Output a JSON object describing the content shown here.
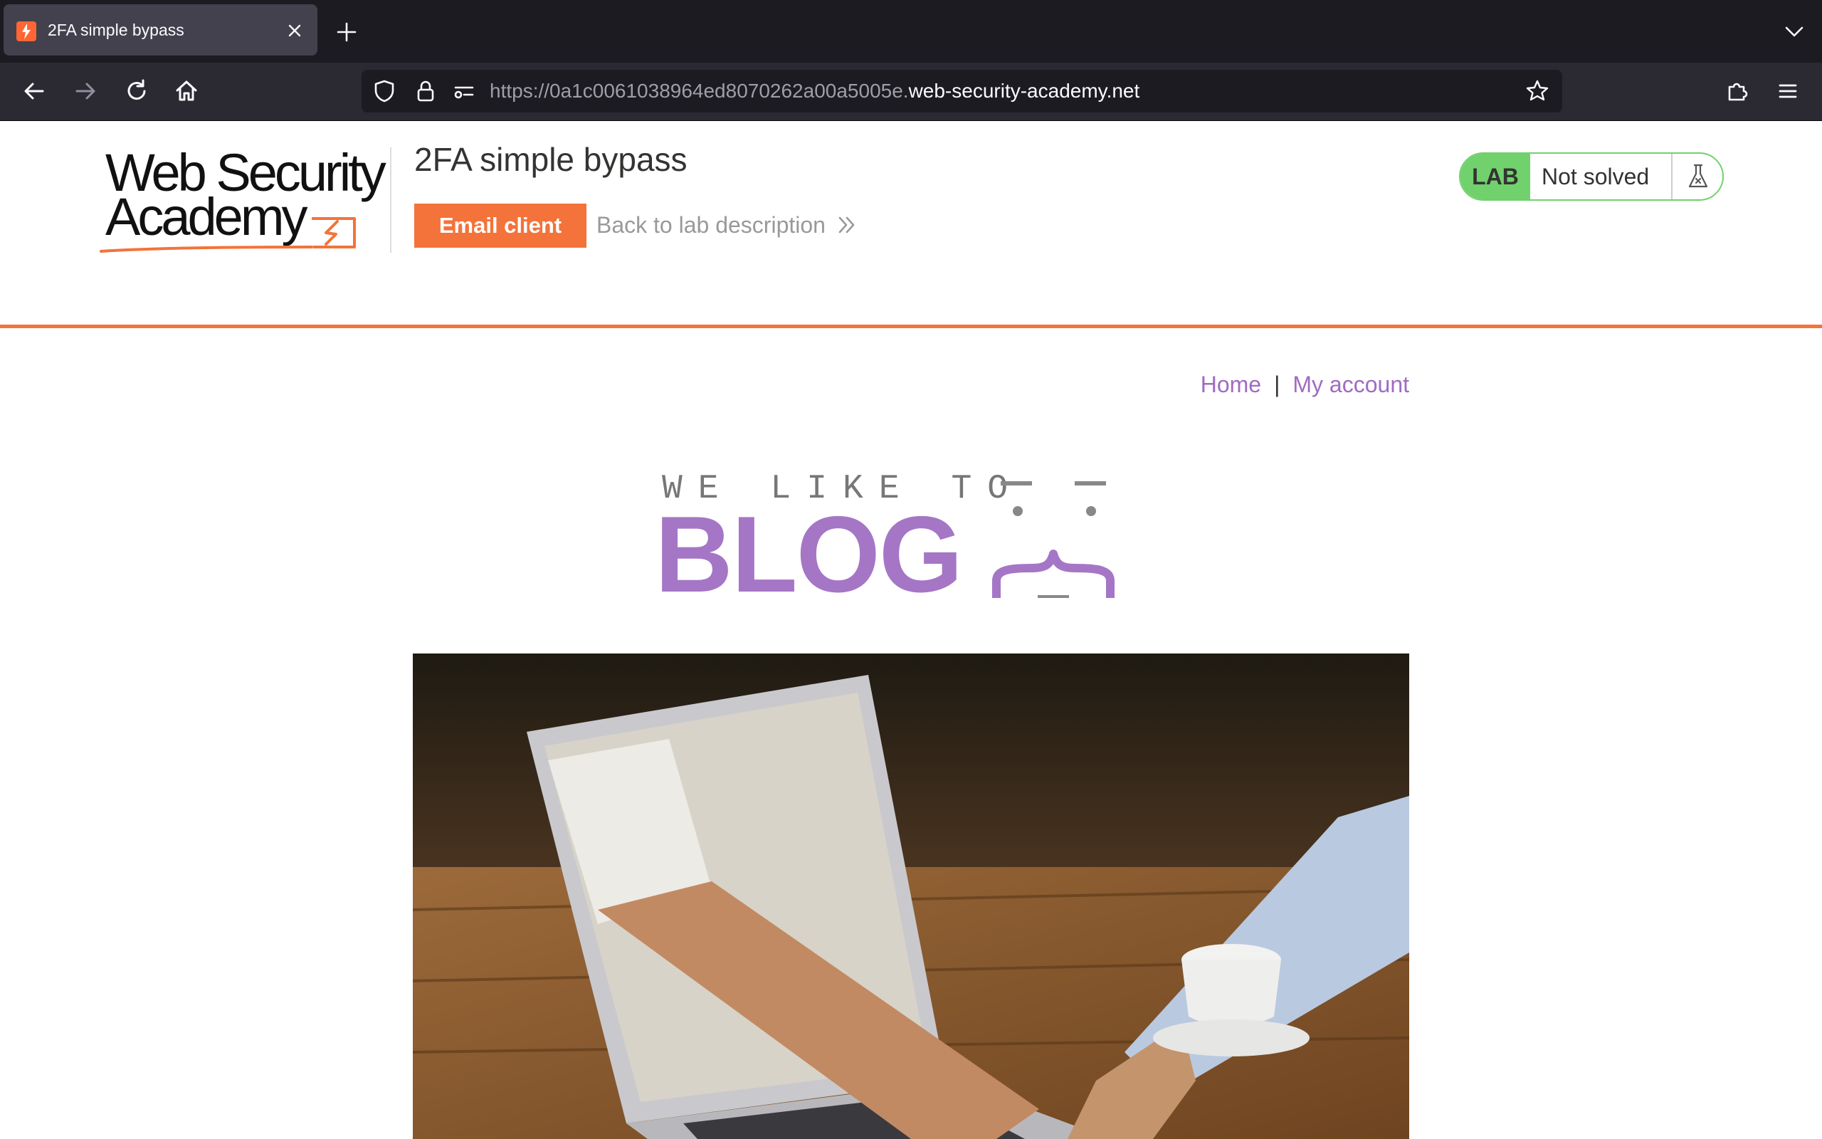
{
  "browser": {
    "tab": {
      "title": "2FA simple bypass"
    },
    "url": {
      "prefix": "https://0a1c0061038964ed8070262a00a5005e.",
      "domain": "web-security-academy.net"
    }
  },
  "header": {
    "logo": {
      "line1": "Web Security",
      "line2": "Academy"
    },
    "lab_title": "2FA simple bypass",
    "email_button": "Email client",
    "back_link": "Back to lab description",
    "status": {
      "badge": "LAB",
      "text": "Not solved"
    }
  },
  "nav": {
    "home": "Home",
    "separator": "|",
    "my_account": "My account"
  },
  "banner": {
    "tagline": "WE LIKE TO",
    "title": "BLOG"
  },
  "colors": {
    "accent": "#f3733a",
    "link": "#a06bc3",
    "lab_green": "#70d16d",
    "blog_purple": "#a576c6"
  },
  "icons": {
    "toolbar": [
      "back-icon",
      "forward-icon",
      "reload-icon",
      "home-icon",
      "shield-icon",
      "lock-icon",
      "permissions-icon",
      "bookmark-star-icon",
      "extensions-icon",
      "menu-icon"
    ]
  }
}
